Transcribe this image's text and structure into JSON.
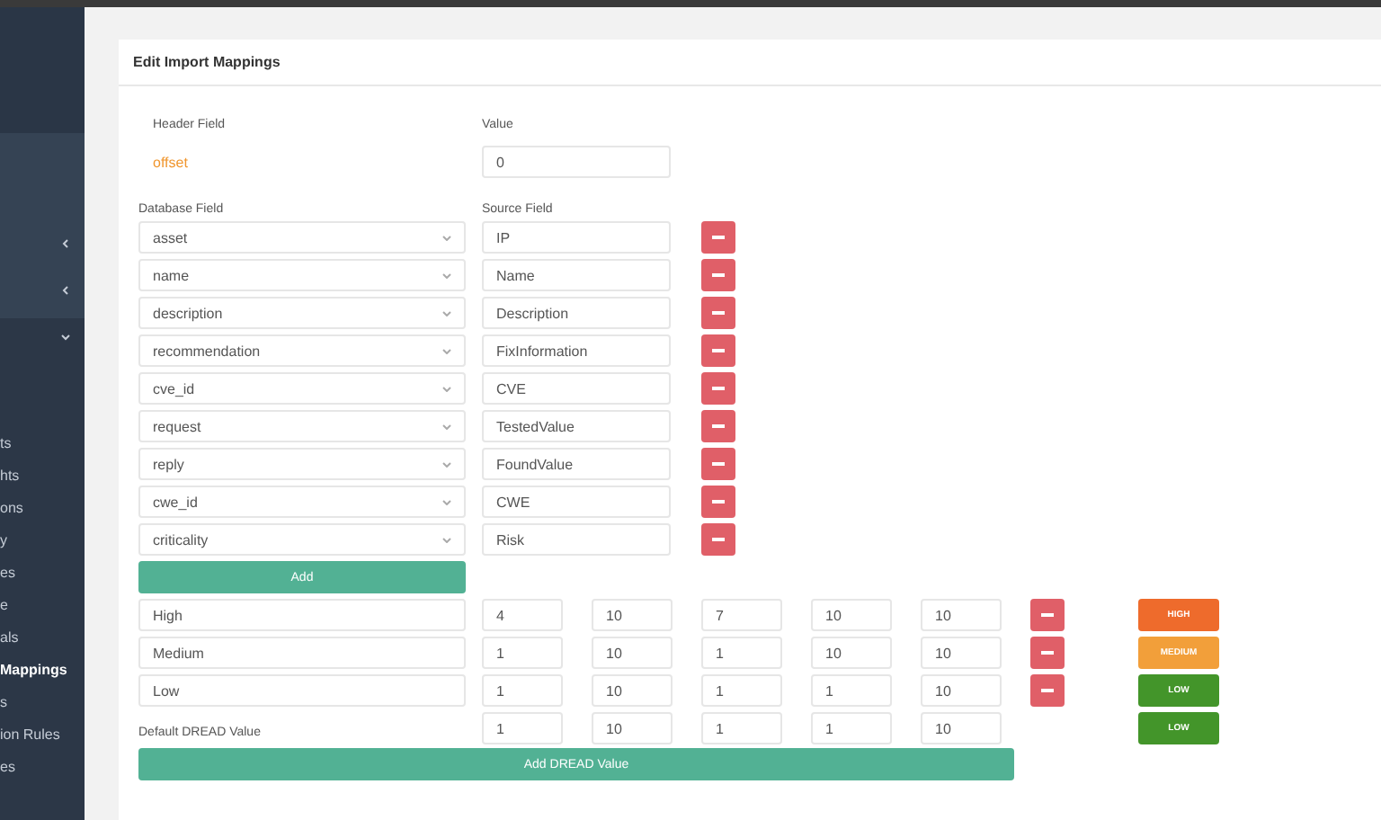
{
  "sidebar": {
    "menus": [
      {
        "expanded": false
      },
      {
        "expanded": false
      },
      {
        "expanded": true
      }
    ],
    "items": [
      {
        "label": "ts",
        "selected": false
      },
      {
        "label": "hts",
        "selected": false
      },
      {
        "label": "ons",
        "selected": false
      },
      {
        "label": "y",
        "selected": false
      },
      {
        "label": "es",
        "selected": false
      },
      {
        "label": "e",
        "selected": false
      },
      {
        "label": "als",
        "selected": false
      },
      {
        "label": "Mappings",
        "selected": true
      },
      {
        "label": "s",
        "selected": false
      },
      {
        "label": "ion Rules",
        "selected": false
      },
      {
        "label": "es",
        "selected": false
      }
    ]
  },
  "card": {
    "title": "Edit Import Mappings",
    "header": {
      "field_label": "Header Field",
      "field_value": "offset",
      "value_label": "Value",
      "value": "0"
    },
    "mapping_labels": {
      "database": "Database Field",
      "source": "Source Field"
    },
    "mappings": [
      {
        "database": "asset",
        "source": "IP"
      },
      {
        "database": "name",
        "source": "Name"
      },
      {
        "database": "description",
        "source": "Description"
      },
      {
        "database": "recommendation",
        "source": "FixInformation"
      },
      {
        "database": "cve_id",
        "source": "CVE"
      },
      {
        "database": "request",
        "source": "TestedValue"
      },
      {
        "database": "reply",
        "source": "FoundValue"
      },
      {
        "database": "cwe_id",
        "source": "CWE"
      },
      {
        "database": "criticality",
        "source": "Risk"
      }
    ],
    "add_button": "Add",
    "dread_rows": [
      {
        "kind": "named",
        "name": "High",
        "values": [
          "4",
          "10",
          "7",
          "10",
          "10"
        ],
        "badge": "HIGH",
        "color": "#ee6b2c"
      },
      {
        "kind": "named",
        "name": "Medium",
        "values": [
          "1",
          "10",
          "1",
          "10",
          "10"
        ],
        "badge": "MEDIUM",
        "color": "#f29f3a"
      },
      {
        "kind": "named",
        "name": "Low",
        "values": [
          "1",
          "10",
          "1",
          "1",
          "10"
        ],
        "badge": "LOW",
        "color": "#43952a"
      },
      {
        "kind": "default",
        "name": "Default DREAD Value",
        "values": [
          "1",
          "10",
          "1",
          "1",
          "10"
        ],
        "badge": "LOW",
        "color": "#43952a"
      }
    ],
    "add_dread_button": "Add DREAD Value"
  }
}
